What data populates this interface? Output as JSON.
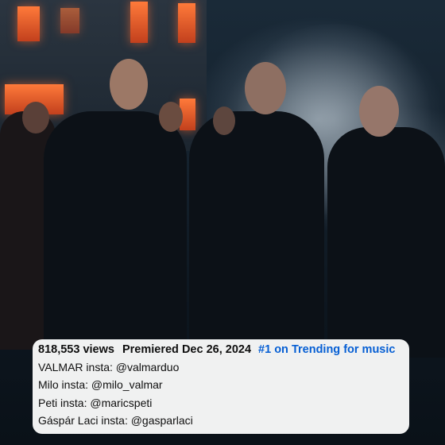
{
  "video": {
    "icon": "music-video-frame"
  },
  "description": {
    "views": "818,553 views",
    "premiered": "Premiered Dec 26, 2024",
    "trending": "#1 on Trending for music",
    "trending_color": "#065fd4",
    "lines": [
      "VALMAR insta: @valmarduo",
      "Milo insta: @milo_valmar",
      "Peti insta: @maricspeti",
      "Gáspár Laci insta: @gasparlaci"
    ]
  }
}
